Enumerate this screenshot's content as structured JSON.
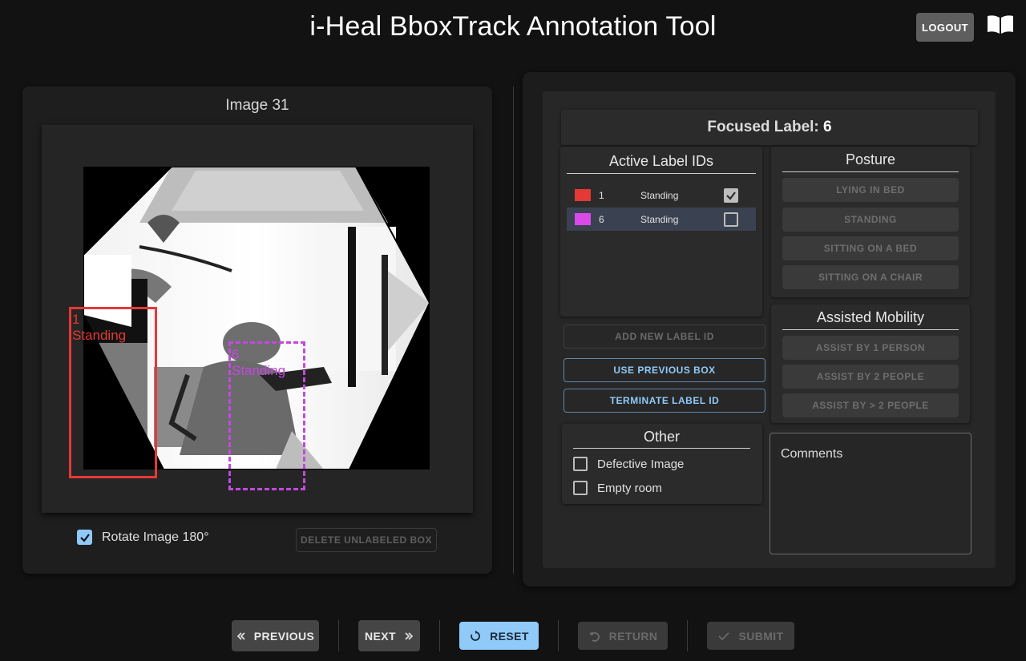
{
  "header": {
    "title": "i-Heal BboxTrack Annotation Tool",
    "logout_label": "LOGOUT"
  },
  "image_panel": {
    "title": "Image 31",
    "boxes": [
      {
        "id": "1",
        "posture": "Standing",
        "color": "#e53935",
        "style": "solid"
      },
      {
        "id": "6",
        "posture": "Standing",
        "color": "#c448e0",
        "style": "dashed"
      }
    ],
    "rotate_label": "Rotate Image 180°",
    "rotate_checked": true,
    "delete_unlabeled_label": "DELETE UNLABELED BOX"
  },
  "focused": {
    "prefix": "Focused Label: ",
    "value": "6"
  },
  "active_labels": {
    "title": "Active Label IDs",
    "rows": [
      {
        "id": "1",
        "posture": "Standing",
        "color": "#e53935",
        "checked": true,
        "selected": false
      },
      {
        "id": "6",
        "posture": "Standing",
        "color": "#d94ae8",
        "checked": false,
        "selected": true
      }
    ]
  },
  "label_actions": {
    "add_new": "ADD NEW LABEL ID",
    "use_previous": "USE PREVIOUS BOX",
    "terminate": "TERMINATE LABEL ID"
  },
  "posture": {
    "title": "Posture",
    "options": [
      "LYING IN BED",
      "STANDING",
      "SITTING ON A BED",
      "SITTING ON A CHAIR"
    ]
  },
  "assisted_mobility": {
    "title": "Assisted Mobility",
    "options": [
      "ASSIST BY 1 PERSON",
      "ASSIST BY 2 PEOPLE",
      "ASSIST BY > 2 PEOPLE"
    ]
  },
  "other": {
    "title": "Other",
    "options": [
      "Defective Image",
      "Empty room"
    ]
  },
  "comments": {
    "placeholder": "Comments"
  },
  "nav": {
    "previous": "PREVIOUS",
    "next": "NEXT",
    "reset": "RESET",
    "return": "RETURN",
    "submit": "SUBMIT"
  }
}
